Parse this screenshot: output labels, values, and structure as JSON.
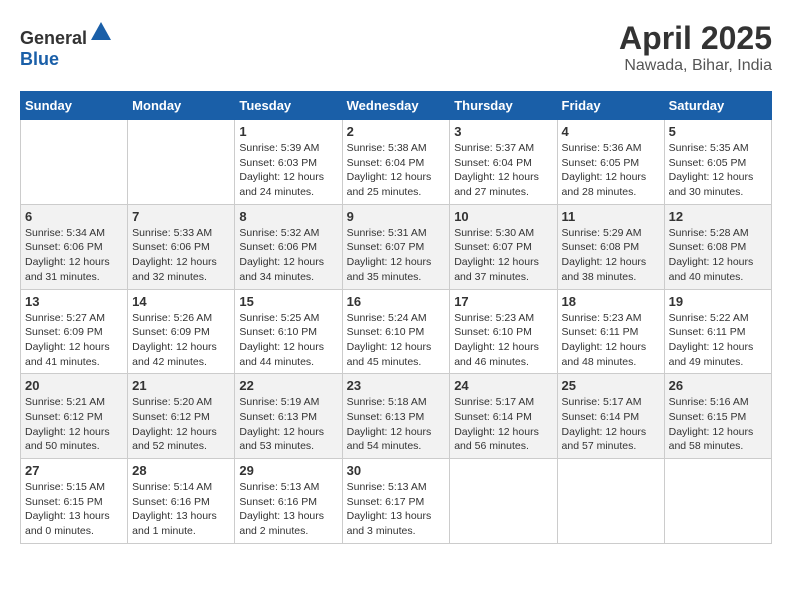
{
  "header": {
    "logo_general": "General",
    "logo_blue": "Blue",
    "month": "April 2025",
    "location": "Nawada, Bihar, India"
  },
  "columns": [
    "Sunday",
    "Monday",
    "Tuesday",
    "Wednesday",
    "Thursday",
    "Friday",
    "Saturday"
  ],
  "weeks": [
    [
      {
        "day": "",
        "info": ""
      },
      {
        "day": "",
        "info": ""
      },
      {
        "day": "1",
        "info": "Sunrise: 5:39 AM\nSunset: 6:03 PM\nDaylight: 12 hours and 24 minutes."
      },
      {
        "day": "2",
        "info": "Sunrise: 5:38 AM\nSunset: 6:04 PM\nDaylight: 12 hours and 25 minutes."
      },
      {
        "day": "3",
        "info": "Sunrise: 5:37 AM\nSunset: 6:04 PM\nDaylight: 12 hours and 27 minutes."
      },
      {
        "day": "4",
        "info": "Sunrise: 5:36 AM\nSunset: 6:05 PM\nDaylight: 12 hours and 28 minutes."
      },
      {
        "day": "5",
        "info": "Sunrise: 5:35 AM\nSunset: 6:05 PM\nDaylight: 12 hours and 30 minutes."
      }
    ],
    [
      {
        "day": "6",
        "info": "Sunrise: 5:34 AM\nSunset: 6:06 PM\nDaylight: 12 hours and 31 minutes."
      },
      {
        "day": "7",
        "info": "Sunrise: 5:33 AM\nSunset: 6:06 PM\nDaylight: 12 hours and 32 minutes."
      },
      {
        "day": "8",
        "info": "Sunrise: 5:32 AM\nSunset: 6:06 PM\nDaylight: 12 hours and 34 minutes."
      },
      {
        "day": "9",
        "info": "Sunrise: 5:31 AM\nSunset: 6:07 PM\nDaylight: 12 hours and 35 minutes."
      },
      {
        "day": "10",
        "info": "Sunrise: 5:30 AM\nSunset: 6:07 PM\nDaylight: 12 hours and 37 minutes."
      },
      {
        "day": "11",
        "info": "Sunrise: 5:29 AM\nSunset: 6:08 PM\nDaylight: 12 hours and 38 minutes."
      },
      {
        "day": "12",
        "info": "Sunrise: 5:28 AM\nSunset: 6:08 PM\nDaylight: 12 hours and 40 minutes."
      }
    ],
    [
      {
        "day": "13",
        "info": "Sunrise: 5:27 AM\nSunset: 6:09 PM\nDaylight: 12 hours and 41 minutes."
      },
      {
        "day": "14",
        "info": "Sunrise: 5:26 AM\nSunset: 6:09 PM\nDaylight: 12 hours and 42 minutes."
      },
      {
        "day": "15",
        "info": "Sunrise: 5:25 AM\nSunset: 6:10 PM\nDaylight: 12 hours and 44 minutes."
      },
      {
        "day": "16",
        "info": "Sunrise: 5:24 AM\nSunset: 6:10 PM\nDaylight: 12 hours and 45 minutes."
      },
      {
        "day": "17",
        "info": "Sunrise: 5:23 AM\nSunset: 6:10 PM\nDaylight: 12 hours and 46 minutes."
      },
      {
        "day": "18",
        "info": "Sunrise: 5:23 AM\nSunset: 6:11 PM\nDaylight: 12 hours and 48 minutes."
      },
      {
        "day": "19",
        "info": "Sunrise: 5:22 AM\nSunset: 6:11 PM\nDaylight: 12 hours and 49 minutes."
      }
    ],
    [
      {
        "day": "20",
        "info": "Sunrise: 5:21 AM\nSunset: 6:12 PM\nDaylight: 12 hours and 50 minutes."
      },
      {
        "day": "21",
        "info": "Sunrise: 5:20 AM\nSunset: 6:12 PM\nDaylight: 12 hours and 52 minutes."
      },
      {
        "day": "22",
        "info": "Sunrise: 5:19 AM\nSunset: 6:13 PM\nDaylight: 12 hours and 53 minutes."
      },
      {
        "day": "23",
        "info": "Sunrise: 5:18 AM\nSunset: 6:13 PM\nDaylight: 12 hours and 54 minutes."
      },
      {
        "day": "24",
        "info": "Sunrise: 5:17 AM\nSunset: 6:14 PM\nDaylight: 12 hours and 56 minutes."
      },
      {
        "day": "25",
        "info": "Sunrise: 5:17 AM\nSunset: 6:14 PM\nDaylight: 12 hours and 57 minutes."
      },
      {
        "day": "26",
        "info": "Sunrise: 5:16 AM\nSunset: 6:15 PM\nDaylight: 12 hours and 58 minutes."
      }
    ],
    [
      {
        "day": "27",
        "info": "Sunrise: 5:15 AM\nSunset: 6:15 PM\nDaylight: 13 hours and 0 minutes."
      },
      {
        "day": "28",
        "info": "Sunrise: 5:14 AM\nSunset: 6:16 PM\nDaylight: 13 hours and 1 minute."
      },
      {
        "day": "29",
        "info": "Sunrise: 5:13 AM\nSunset: 6:16 PM\nDaylight: 13 hours and 2 minutes."
      },
      {
        "day": "30",
        "info": "Sunrise: 5:13 AM\nSunset: 6:17 PM\nDaylight: 13 hours and 3 minutes."
      },
      {
        "day": "",
        "info": ""
      },
      {
        "day": "",
        "info": ""
      },
      {
        "day": "",
        "info": ""
      }
    ]
  ]
}
